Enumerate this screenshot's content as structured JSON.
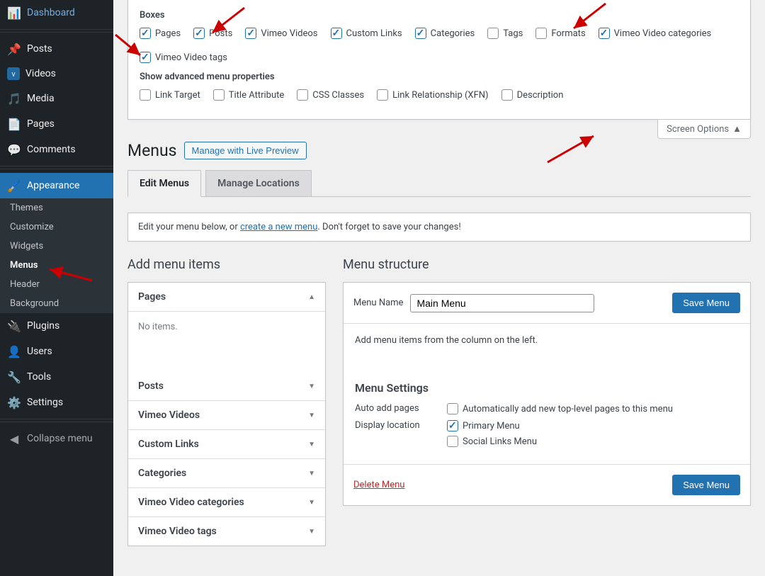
{
  "sidebar": {
    "items": [
      {
        "label": "Dashboard",
        "icon": "⌂"
      },
      {
        "label": "Posts",
        "icon": "✎"
      },
      {
        "label": "Videos",
        "icon": "▣"
      },
      {
        "label": "Media",
        "icon": "✧"
      },
      {
        "label": "Pages",
        "icon": "❐"
      },
      {
        "label": "Comments",
        "icon": "💬"
      },
      {
        "label": "Appearance",
        "icon": "🖌"
      },
      {
        "label": "Plugins",
        "icon": "◆"
      },
      {
        "label": "Users",
        "icon": "👤"
      },
      {
        "label": "Tools",
        "icon": "🔧"
      },
      {
        "label": "Settings",
        "icon": "⚙"
      },
      {
        "label": "Collapse menu",
        "icon": "◀"
      }
    ],
    "appearance_sub": [
      "Themes",
      "Customize",
      "Widgets",
      "Menus",
      "Header",
      "Background"
    ]
  },
  "screen_options": {
    "boxes_title": "Boxes",
    "boxes": [
      {
        "label": "Pages",
        "checked": true
      },
      {
        "label": "Posts",
        "checked": true
      },
      {
        "label": "Vimeo Videos",
        "checked": true
      },
      {
        "label": "Custom Links",
        "checked": true
      },
      {
        "label": "Categories",
        "checked": true
      },
      {
        "label": "Tags",
        "checked": false
      },
      {
        "label": "Formats",
        "checked": false
      },
      {
        "label": "Vimeo Video categories",
        "checked": true
      },
      {
        "label": "Vimeo Video tags",
        "checked": true
      }
    ],
    "advanced_title": "Show advanced menu properties",
    "advanced": [
      {
        "label": "Link Target",
        "checked": false
      },
      {
        "label": "Title Attribute",
        "checked": false
      },
      {
        "label": "CSS Classes",
        "checked": false
      },
      {
        "label": "Link Relationship (XFN)",
        "checked": false
      },
      {
        "label": "Description",
        "checked": false
      }
    ],
    "tab_label": "Screen Options"
  },
  "page": {
    "title": "Menus",
    "live_preview": "Manage with Live Preview",
    "tabs": {
      "edit": "Edit Menus",
      "locations": "Manage Locations"
    },
    "notice_prefix": "Edit your menu below, or ",
    "notice_link": "create a new menu",
    "notice_suffix": ". Don't forget to save your changes!"
  },
  "add_items": {
    "heading": "Add menu items",
    "pages_title": "Pages",
    "no_items": "No items.",
    "sections": [
      "Posts",
      "Vimeo Videos",
      "Custom Links",
      "Categories",
      "Vimeo Video categories",
      "Vimeo Video tags"
    ]
  },
  "structure": {
    "heading": "Menu structure",
    "name_label": "Menu Name",
    "name_value": "Main Menu",
    "save": "Save Menu",
    "hint": "Add menu items from the column on the left.",
    "settings_title": "Menu Settings",
    "auto_add_label": "Auto add pages",
    "auto_add_text": "Automatically add new top-level pages to this menu",
    "display_label": "Display location",
    "primary": "Primary Menu",
    "social": "Social Links Menu",
    "delete": "Delete Menu"
  }
}
